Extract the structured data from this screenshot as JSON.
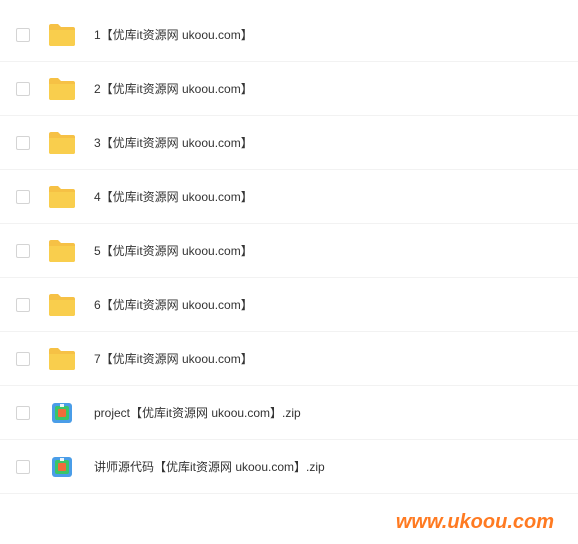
{
  "files": [
    {
      "name": "1【优库it资源网 ukoou.com】",
      "type": "folder"
    },
    {
      "name": "2【优库it资源网 ukoou.com】",
      "type": "folder"
    },
    {
      "name": "3【优库it资源网 ukoou.com】",
      "type": "folder"
    },
    {
      "name": "4【优库it资源网 ukoou.com】",
      "type": "folder"
    },
    {
      "name": "5【优库it资源网 ukoou.com】",
      "type": "folder"
    },
    {
      "name": "6【优库it资源网 ukoou.com】",
      "type": "folder"
    },
    {
      "name": "7【优库it资源网 ukoou.com】",
      "type": "folder"
    },
    {
      "name": "project【优库it资源网 ukoou.com】.zip",
      "type": "zip"
    },
    {
      "name": "讲师源代码【优库it资源网 ukoou.com】.zip",
      "type": "zip"
    }
  ],
  "watermark": "www.ukoou.com"
}
